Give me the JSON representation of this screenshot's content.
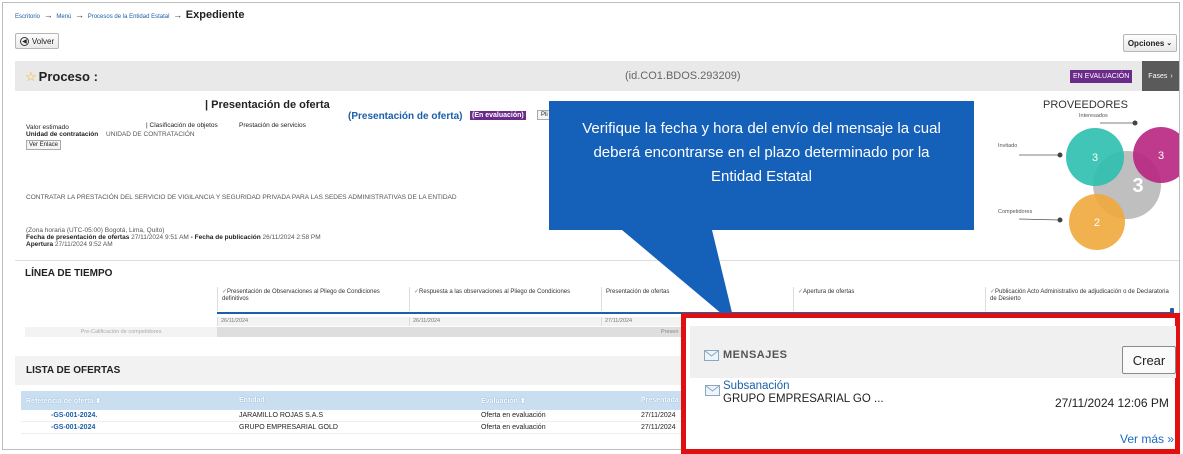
{
  "breadcrumb": {
    "items": [
      "Escritorio",
      "Menú",
      "Procesos de la Entidad Estatal"
    ],
    "separator": "→",
    "current": "Expediente"
  },
  "toolbar": {
    "back_label": "Volver",
    "options_label": "Opciones"
  },
  "process": {
    "title": "Proceso :",
    "id": "(id.CO1.BDOS.293209)",
    "status_badge": "EN EVALUACIÓN",
    "phases_label": "Fases"
  },
  "details": {
    "heading": "| Presentación de oferta",
    "phase_link": "(Presentación de oferta)",
    "phase_badge": "(En evaluación)",
    "pliego_btn": "Pli",
    "valor_label": "Valor estimado",
    "clasif_label": "| Clasificación de objetos",
    "clasif_value": "Prestación de servicios",
    "unidad_label": "Unidad de contratación",
    "unidad_value": "UNIDAD DE CONTRATACIÓN",
    "link_button": "Ver Enlace",
    "description": "CONTRATAR LA PRESTACIÓN DEL SERVICIO DE VIGILANCIA Y SEGURIDAD PRIVADA PARA LAS SEDES ADMINISTRATIVAS DE LA ENTIDAD",
    "timezone": "(Zona horaria (UTC-05:00) Bogotá, Lima, Quito)",
    "fecha_presentacion_label": "Fecha de presentación de ofertas",
    "fecha_presentacion_value": "27/11/2024 9:51 AM",
    "fecha_publicacion_label": "- Fecha de publicación",
    "fecha_publicacion_value": "26/11/2024 2:58 PM",
    "apertura_label": "Apertura",
    "apertura_value": "27/11/2024 9:52 AM"
  },
  "providers": {
    "title": "PROVEEDORES",
    "interesados_label": "Interesados",
    "invitado_label": "Invitado",
    "competidores_label": "Competidores",
    "invitado_count": "3",
    "interesados_count": "3",
    "total_count": "3",
    "competidores_count": "2",
    "colors": {
      "teal": "#2bbfae",
      "magenta": "#b8237f",
      "gray": "#b4b4b4",
      "orange": "#f0a93c"
    }
  },
  "timeline": {
    "heading": "LÍNEA DE TIEMPO",
    "columns": [
      "Presentación de Observaciones al Pliego de Condiciones definitivos",
      "Respuesta a las observaciones al Pliego de Condiciones",
      "Presentación de ofertas",
      "Apertura de ofertas",
      "Publicación Acto Administrativo de adjudicación o de Declaratoria de Desierto"
    ],
    "dates": [
      "26/11/2024",
      "26/11/2024",
      "27/11/2024",
      "",
      ""
    ],
    "precalificacion": "Pre-Calificación de competidores",
    "bar_label": "Presen"
  },
  "offers": {
    "heading": "LISTA DE OFERTAS",
    "headers": [
      "Referencia de oferta",
      "Entidad",
      "Evaluación",
      "Presentada"
    ],
    "rows": [
      [
        "-GS-001-2024.",
        "JARAMILLO ROJAS S.A.S",
        "Oferta en evaluación",
        "27/11/2024"
      ],
      [
        "-GS-001-2024",
        "GRUPO EMPRESARIAL GOLD",
        "Oferta en evaluación",
        "27/11/2024"
      ]
    ]
  },
  "messages": {
    "title": "MENSAJES",
    "create_label": "Crear",
    "item_subject": "Subsanación",
    "item_from": "GRUPO EMPRESARIAL GO ...",
    "item_date": "27/11/2024 12:06 PM",
    "more_label": "Ver más »"
  },
  "callout": {
    "text": "Verifique la fecha y hora del envío del mensaje la cual deberá encontrarse en el plazo determinado por la Entidad Estatal"
  }
}
